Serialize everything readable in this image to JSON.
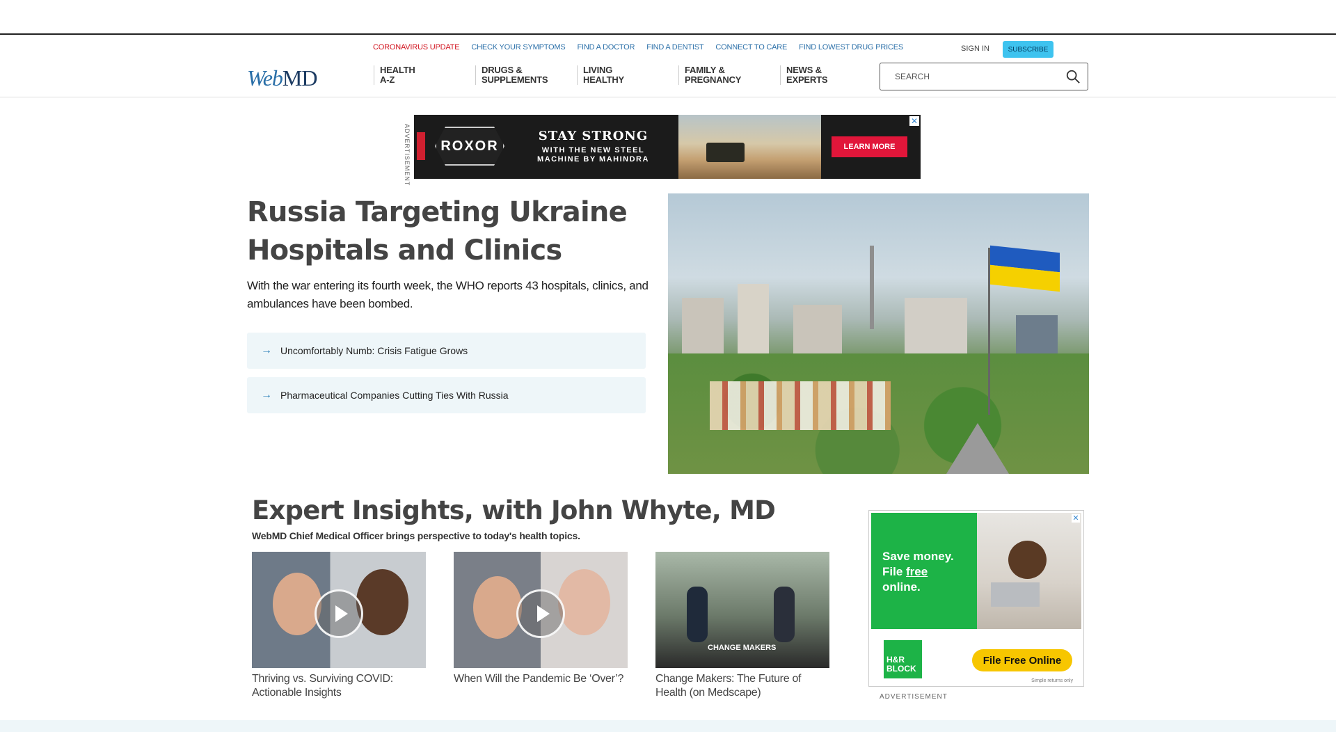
{
  "utility_nav": {
    "items": [
      {
        "label": "CORONAVIRUS UPDATE"
      },
      {
        "label": "CHECK YOUR SYMPTOMS"
      },
      {
        "label": "FIND A DOCTOR"
      },
      {
        "label": "FIND A DENTIST"
      },
      {
        "label": "CONNECT TO CARE"
      },
      {
        "label": "FIND LOWEST DRUG PRICES"
      }
    ],
    "sign_in": "SIGN IN",
    "subscribe": "SUBSCRIBE"
  },
  "logo": {
    "part1": "Web",
    "part2": "MD"
  },
  "main_nav": {
    "items": [
      {
        "line1": "HEALTH",
        "line2": "A-Z"
      },
      {
        "line1": "DRUGS &",
        "line2": "SUPPLEMENTS"
      },
      {
        "line1": "LIVING",
        "line2": "HEALTHY"
      },
      {
        "line1": "FAMILY &",
        "line2": "PREGNANCY"
      },
      {
        "line1": "NEWS &",
        "line2": "EXPERTS"
      }
    ]
  },
  "search": {
    "placeholder": "SEARCH",
    "icon": "search-icon"
  },
  "top_ad": {
    "label": "ADVERTISEMENT",
    "brand": "ROXOR",
    "headline": "STAY STRONG",
    "subline1": "WITH THE NEW STEEL",
    "subline2": "MACHINE BY MAHINDRA",
    "cta": "LEARN MORE",
    "close": "✕"
  },
  "hero": {
    "title": "Russia Targeting Ukraine Hospitals and Clinics",
    "subtitle": "With the war entering its fourth week, the WHO reports 43 hospitals, clinics, and ambulances have been bombed.",
    "related": [
      {
        "label": "Uncomfortably Numb: Crisis Fatigue Grows"
      },
      {
        "label": "Pharmaceutical Companies Cutting Ties With Russia"
      }
    ]
  },
  "expert_section": {
    "title": "Expert Insights, with John Whyte, MD",
    "subtitle": "WebMD Chief Medical Officer brings perspective to today's health topics.",
    "cards": [
      {
        "caption": "Thriving vs. Surviving COVID: Actionable Insights"
      },
      {
        "caption": "When Will the Pandemic Be ‘Over’?"
      },
      {
        "caption": "Change Makers: The Future of Health (on Medscape)",
        "overlay": "CHANGE MAKERS"
      }
    ]
  },
  "right_ad": {
    "line1": "Save money.",
    "line2a": "File ",
    "line2b": "free",
    "line3": "online.",
    "brand1": "H&R",
    "brand2": "BLOCK",
    "cta": "File Free Online",
    "fine": "Simple returns only",
    "close": "✕",
    "caption": "ADVERTISEMENT"
  },
  "colors": {
    "link_blue": "#2a6fa8",
    "alert_red": "#d1121d",
    "subscribe_bg": "#3ec3ef",
    "related_bg": "#eef6f9"
  }
}
